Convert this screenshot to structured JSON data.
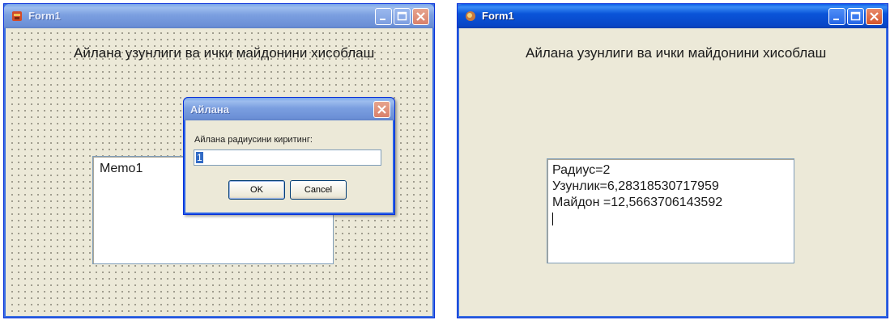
{
  "left_window": {
    "title": "Form1",
    "heading": "Айлана узунлиги ва ички майдонини хисоблаш",
    "memo_text": "Memo1",
    "dialog": {
      "title": "Айлана",
      "prompt": "Айлана радиусини киритинг:",
      "input_value": "1",
      "ok_label": "OK",
      "cancel_label": "Cancel"
    }
  },
  "right_window": {
    "title": "Form1",
    "heading": "Айлана узунлиги ва ички майдонини хисоблаш",
    "memo_lines": [
      "Радиус=2",
      "Узунлик=6,28318530717959",
      "Майдон =12,5663706143592"
    ]
  },
  "icons": {
    "minimize": "minimize-icon",
    "maximize": "maximize-icon",
    "close": "close-icon"
  }
}
